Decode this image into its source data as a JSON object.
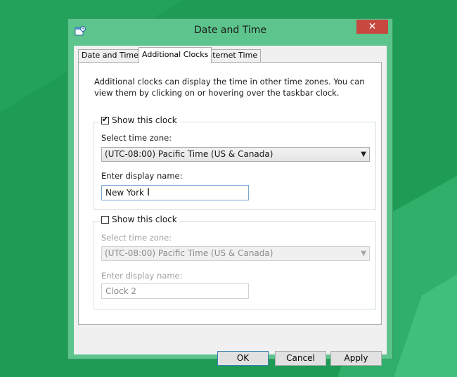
{
  "window": {
    "title": "Date and Time",
    "close_glyph": "✕"
  },
  "tabs": [
    {
      "label": "Date and Time",
      "active": false
    },
    {
      "label": "Additional Clocks",
      "active": true
    },
    {
      "label": "Internet Time",
      "active": false
    }
  ],
  "intro_text": "Additional clocks can display the time in other time zones. You can view them by clicking on or hovering over the taskbar clock.",
  "clock1": {
    "show_label": "Show this clock",
    "checked": true,
    "timezone_label": "Select time zone:",
    "timezone_value": "(UTC-08:00) Pacific Time (US & Canada)",
    "display_name_label": "Enter display name:",
    "display_name_value": "New York"
  },
  "clock2": {
    "show_label": "Show this clock",
    "checked": false,
    "timezone_label": "Select time zone:",
    "timezone_value": "(UTC-08:00) Pacific Time (US & Canada)",
    "display_name_label": "Enter display name:",
    "display_name_value": "Clock 2"
  },
  "buttons": {
    "ok": "OK",
    "cancel": "Cancel",
    "apply": "Apply"
  },
  "colors": {
    "desktop": "#1e9b55",
    "window_frame": "#5cc48c",
    "close_button": "#c7483f"
  }
}
